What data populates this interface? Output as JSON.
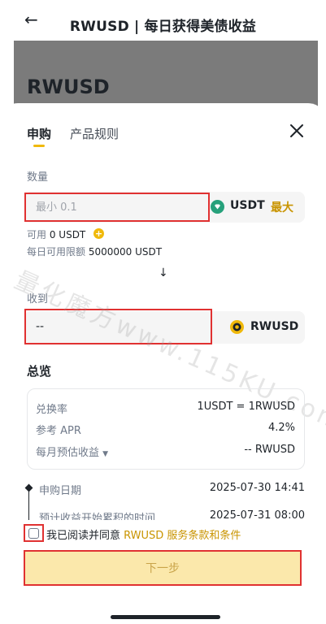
{
  "header": {
    "title": "RWUSD | 每日获得美债收益"
  },
  "hero": {
    "title": "RWUSD"
  },
  "tabs": [
    {
      "label": "申购"
    },
    {
      "label": "产品规则"
    }
  ],
  "amount": {
    "section_label": "数量",
    "placeholder": "最小 0.1",
    "coin": "USDT",
    "max_label": "最大",
    "available_label": "可用",
    "available_value": "0 USDT",
    "daily_limit_label": "每日可用限额",
    "daily_limit_value": "5000000 USDT"
  },
  "receive": {
    "section_label": "收到",
    "value": "--",
    "coin": "RWUSD"
  },
  "overview": {
    "title": "总览",
    "rows": [
      {
        "label": "兑换率",
        "value": "1USDT = 1RWUSD"
      },
      {
        "label": "参考 APR",
        "value": "4.2%"
      },
      {
        "label": "每月预估收益",
        "value": "-- RWUSD"
      }
    ]
  },
  "timeline": [
    {
      "label": "申购日期",
      "value": "2025-07-30 14:41"
    },
    {
      "label": "预计收益开始累积的时间",
      "value": "2025-07-31 08:00"
    }
  ],
  "agreement": {
    "prefix": "我已阅读并同意",
    "link": "RWUSD 服务条款和条件"
  },
  "next_button": {
    "label": "下一步"
  },
  "watermark": {
    "text": "量化魔方www.115KU.com"
  },
  "colors": {
    "accent": "#f0b90b",
    "link": "#c99400",
    "highlight": "#e03131",
    "button_bg": "#fbe8ab"
  },
  "icons": {
    "back": "arrow-left-icon",
    "close": "close-icon",
    "down": "arrow-down-icon",
    "usdt": "tether-icon",
    "rwusd": "rwusd-coin-icon"
  }
}
